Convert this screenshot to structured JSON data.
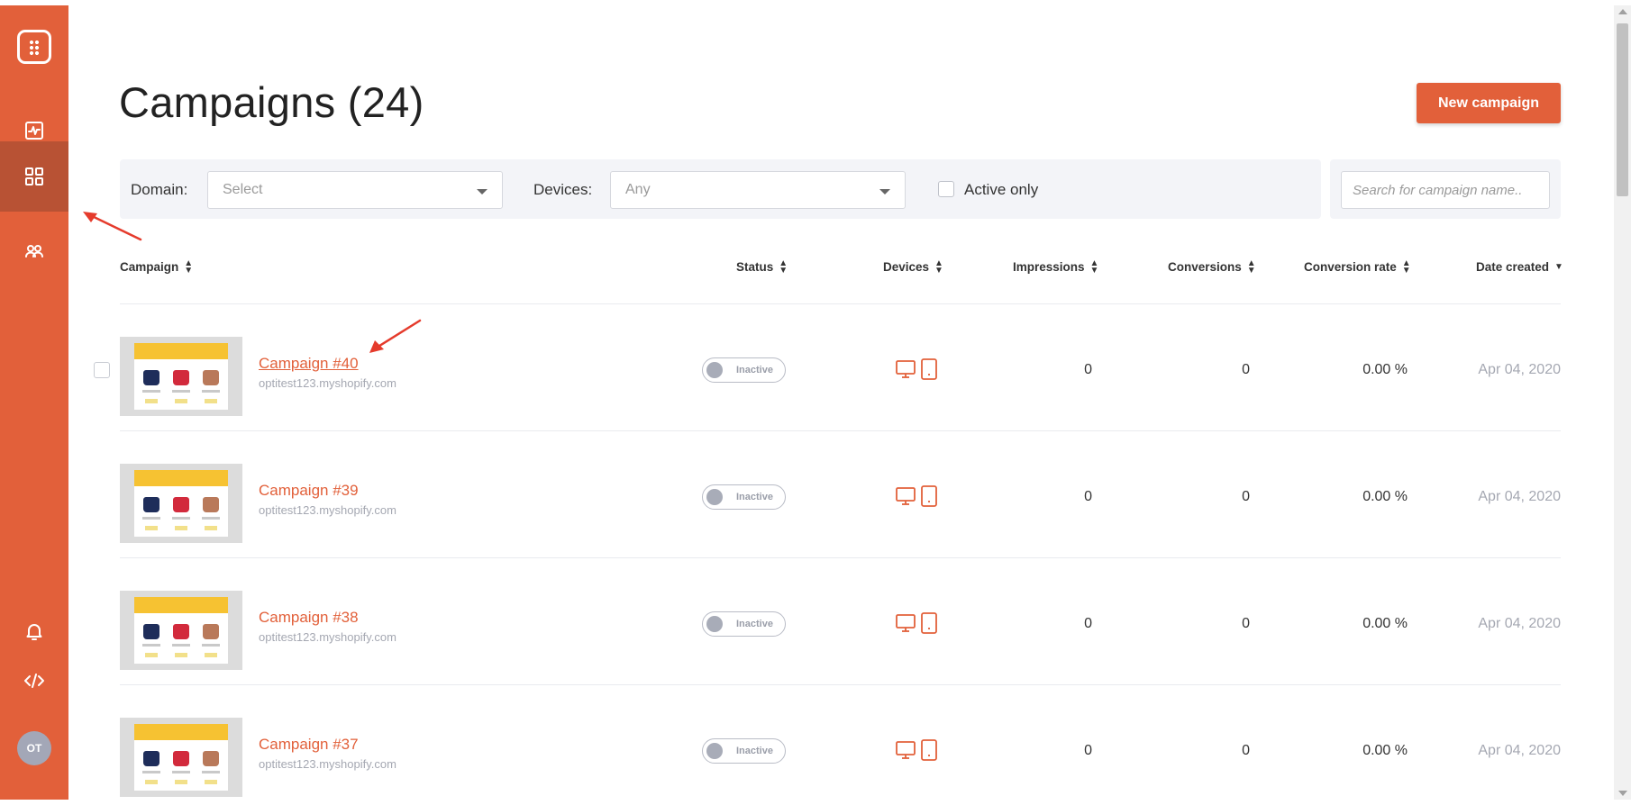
{
  "page": {
    "title": "Campaigns (24)",
    "new_button": "New campaign"
  },
  "sidebar": {
    "items": [
      {
        "icon": "dashboard-activity-icon"
      },
      {
        "icon": "campaigns-grid-icon",
        "active": true
      },
      {
        "icon": "users-icon"
      }
    ],
    "bottom": [
      {
        "icon": "bell-icon"
      },
      {
        "icon": "code-icon"
      }
    ],
    "avatar": "OT",
    "accent": "#e2603a",
    "active_bg": "#b85234"
  },
  "filters": {
    "domain_label": "Domain:",
    "domain_value": "Select",
    "devices_label": "Devices:",
    "devices_value": "Any",
    "active_only_label": "Active only",
    "search_placeholder": "Search for campaign name.."
  },
  "table": {
    "headers": {
      "campaign": "Campaign",
      "status": "Status",
      "devices": "Devices",
      "impressions": "Impressions",
      "conversions": "Conversions",
      "conversion_rate": "Conversion rate",
      "date_created": "Date created"
    },
    "rows": [
      {
        "name": "Campaign #40",
        "domain": "optitest123.myshopify.com",
        "status": "Inactive",
        "impressions": "0",
        "conversions": "0",
        "rate": "0.00 %",
        "date": "Apr 04, 2020"
      },
      {
        "name": "Campaign #39",
        "domain": "optitest123.myshopify.com",
        "status": "Inactive",
        "impressions": "0",
        "conversions": "0",
        "rate": "0.00 %",
        "date": "Apr 04, 2020"
      },
      {
        "name": "Campaign #38",
        "domain": "optitest123.myshopify.com",
        "status": "Inactive",
        "impressions": "0",
        "conversions": "0",
        "rate": "0.00 %",
        "date": "Apr 04, 2020"
      },
      {
        "name": "Campaign #37",
        "domain": "optitest123.myshopify.com",
        "status": "Inactive",
        "impressions": "0",
        "conversions": "0",
        "rate": "0.00 %",
        "date": "Apr 04, 2020"
      }
    ]
  }
}
